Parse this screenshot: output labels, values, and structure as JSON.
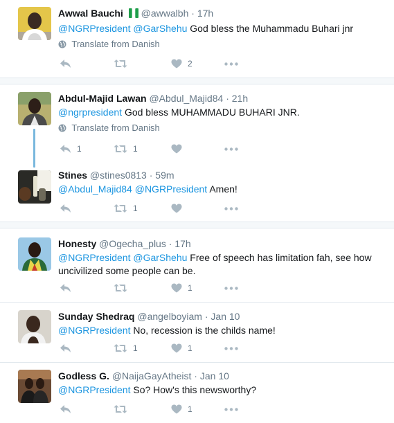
{
  "tweets": [
    {
      "fullname": "Awwal Bauchi",
      "handle": "@awwalbh",
      "sep": "·",
      "time": "17h",
      "mentions": [
        "@NGRPresident",
        "@GarShehu"
      ],
      "body": "God bless the Muhammadu Buhari jnr",
      "translate": "Translate from Danish",
      "reply_count": "",
      "retweet_count": "",
      "like_count": "2"
    },
    {
      "fullname": "Abdul-Majid Lawan",
      "handle": "@Abdul_Majid84",
      "sep": "·",
      "time": "21h",
      "mentions": [
        "@ngrpresident"
      ],
      "body": "God bless MUHAMMADU BUHARI JNR.",
      "translate": "Translate from Danish",
      "reply_count": "1",
      "retweet_count": "1",
      "like_count": ""
    },
    {
      "fullname": "Stines",
      "handle": "@stines0813",
      "sep": "·",
      "time": "59m",
      "mentions": [
        "@Abdul_Majid84",
        "@NGRPresident"
      ],
      "body": "Amen!",
      "reply_count": "",
      "retweet_count": "1",
      "like_count": ""
    },
    {
      "fullname": "Honesty",
      "handle": "@Ogecha_plus",
      "sep": "·",
      "time": "17h",
      "mentions": [
        "@NGRPresident",
        "@GarShehu"
      ],
      "body_line1": "Free of speech has limitation fah, see how",
      "body_line2": "uncivilized some people can be.",
      "reply_count": "",
      "retweet_count": "",
      "like_count": "1"
    },
    {
      "fullname": "Sunday Shedraq",
      "handle": "@angelboyiam",
      "sep": "·",
      "time": "Jan 10",
      "mentions": [
        "@NGRPresident"
      ],
      "body": "No, recession is the childs name!",
      "reply_count": "",
      "retweet_count": "1",
      "like_count": "1"
    },
    {
      "fullname": "Godless G.",
      "handle": "@NaijaGayAtheist",
      "sep": "·",
      "time": "Jan 10",
      "mentions": [
        "@NGRPresident"
      ],
      "body": "So? How's this newsworthy?",
      "reply_count": "",
      "retweet_count": "",
      "like_count": "1"
    }
  ],
  "icons": {
    "reply": "reply-icon",
    "retweet": "retweet-icon",
    "like": "heart-icon",
    "more": "more-icon",
    "globe": "globe-icon",
    "flag": "nigeria-flag-icon"
  },
  "colors": {
    "mention": "#1b95e0",
    "secondary": "#657786",
    "action_icon": "#aab8c2",
    "thread_line": "#7ab8dd",
    "gap_bg": "#f5f8fa"
  }
}
